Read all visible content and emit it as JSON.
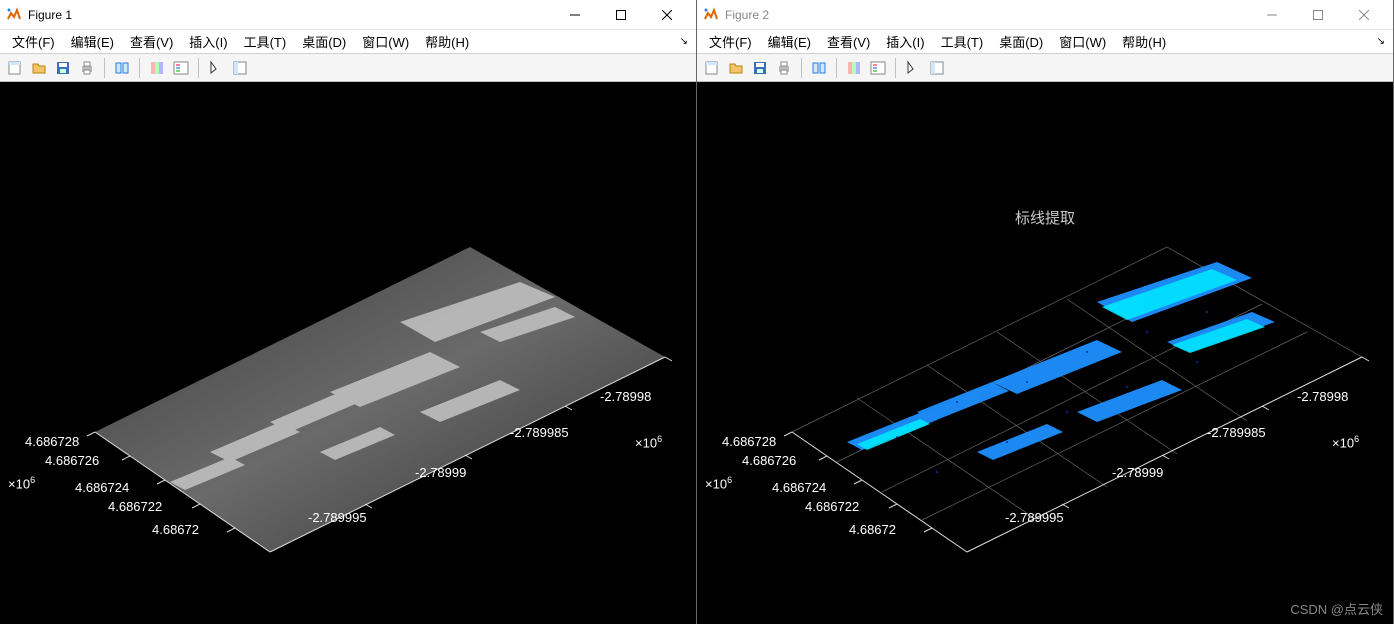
{
  "windows": [
    {
      "title": "Figure 1",
      "active": true
    },
    {
      "title": "Figure 2",
      "active": false
    }
  ],
  "menus": {
    "file": "文件(F)",
    "edit": "编辑(E)",
    "view": "查看(V)",
    "insert": "插入(I)",
    "tools": "工具(T)",
    "desktop": "桌面(D)",
    "window": "窗口(W)",
    "help": "帮助(H)"
  },
  "plot": {
    "title_fig2": "标线提取",
    "y_ticks": [
      "4.686728",
      "4.686726",
      "4.686724",
      "4.686722",
      "4.68672"
    ],
    "x_ticks": [
      "-2.78998",
      "-2.789985",
      "-2.78999",
      "-2.789995"
    ],
    "y_exp": "×10",
    "y_exp_sup": "6",
    "x_exp": "×10",
    "x_exp_sup": "6"
  },
  "watermark": "CSDN @点云侠",
  "chart_data": {
    "type": "scatter",
    "description": "Two MATLAB 3D figure windows showing a road-surface point cloud. Figure 1 renders the full grey intensity surface with visible lane-marking arrows; Figure 2 (titled 标线提取 = 'lane marking extraction') shows only the extracted bright lane-marking points colored by a blue/cyan colormap.",
    "x_range": [
      -2789995.0,
      -2789980.0
    ],
    "y_range": [
      4686720.0,
      4686728.0
    ],
    "xlabel": "",
    "ylabel": "",
    "x_ticks": [
      -2789980.0,
      -2789985.0,
      -2789990.0,
      -2789995.0
    ],
    "y_ticks": [
      4686728.0,
      4686726.0,
      4686724.0,
      4686722.0,
      4686720.0
    ],
    "axis_multiplier": 1000000.0
  }
}
